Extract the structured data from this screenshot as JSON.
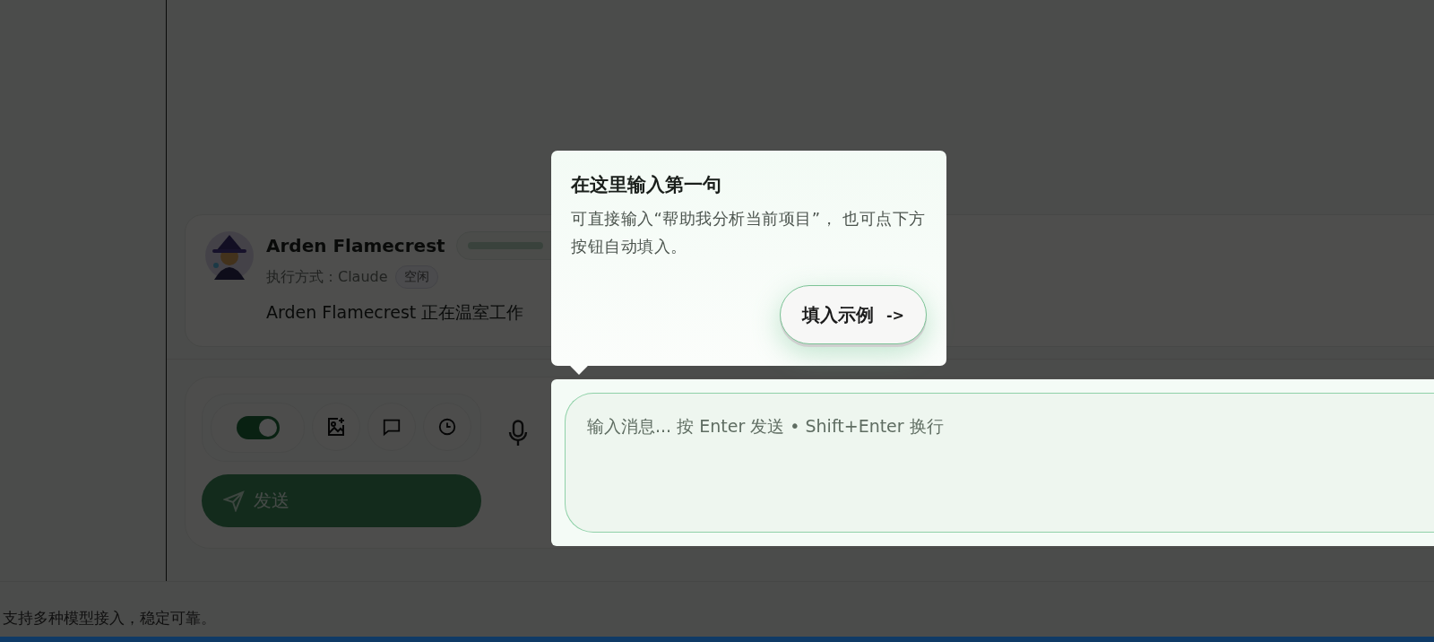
{
  "agent": {
    "name": "Arden Flamecrest",
    "executor": "执行方式：Claude",
    "status": "空闲",
    "message": "Arden Flamecrest 正在温室工作"
  },
  "composer": {
    "toggle": {
      "on": true
    },
    "send_button": "发送",
    "input": {
      "placeholder": "输入消息... 按 Enter 发送 • Shift+Enter 换行"
    }
  },
  "tour": {
    "title": "在这里输入第一句",
    "body": "可直接输入“帮助我分析当前项目”， 也可点下方按钮自动填入。",
    "button": "填入示例",
    "button_arrow": "->"
  },
  "footer": {
    "text": "支持多种模型接入，稳定可靠。"
  }
}
